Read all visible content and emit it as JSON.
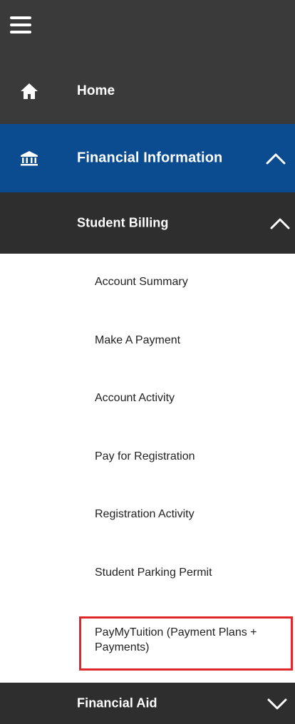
{
  "nav": {
    "home": {
      "label": "Home"
    },
    "financial_information": {
      "label": "Financial Information",
      "expanded": true
    },
    "student_billing": {
      "label": "Student Billing",
      "expanded": true,
      "items": [
        "Account Summary",
        "Make A Payment",
        "Account Activity",
        "Pay for Registration",
        "Registration Activity",
        "Student Parking Permit",
        "PayMyTuition (Payment Plans + Payments)"
      ]
    },
    "financial_aid": {
      "label": "Financial Aid",
      "expanded": false
    }
  },
  "colors": {
    "dark_bg": "#3a3a3a",
    "darker_bg": "#2e2e2e",
    "active_blue": "#0b4b8f",
    "highlight_red": "#e0262b"
  },
  "icons": {
    "menu": "hamburger-menu-icon",
    "home": "home-icon",
    "financial": "bank-building-icon",
    "expand": "chevron-up-icon",
    "collapse": "chevron-down-icon"
  }
}
